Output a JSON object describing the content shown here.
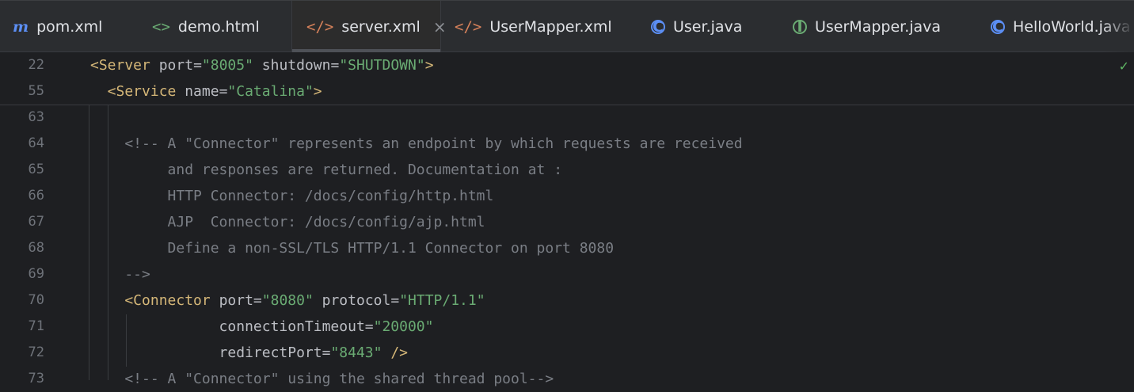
{
  "tabs": [
    {
      "label": "pom.xml",
      "icon": "maven-m-icon",
      "active": false
    },
    {
      "label": "demo.html",
      "icon": "html-tag-icon",
      "active": false
    },
    {
      "label": "server.xml",
      "icon": "xml-tag-icon",
      "active": true
    },
    {
      "label": "UserMapper.xml",
      "icon": "xml-tag-icon",
      "active": false
    },
    {
      "label": "User.java",
      "icon": "java-class-icon",
      "active": false
    },
    {
      "label": "UserMapper.java",
      "icon": "java-interface-icon",
      "active": false
    },
    {
      "label": "HelloWorld.java",
      "icon": "java-class-run-icon",
      "active": false
    }
  ],
  "tab_close_glyph": "×",
  "icon_glyphs": {
    "maven": "m",
    "html": "<>",
    "xml": "</>",
    "class": "C",
    "iface": "I"
  },
  "inspection_status": "✓",
  "editor": {
    "lines": [
      {
        "num": "22",
        "sticky": true,
        "segments": [
          [
            "tag",
            "<Server "
          ],
          [
            "attr",
            "port"
          ],
          [
            "pl",
            "="
          ],
          [
            "str",
            "\"8005\""
          ],
          [
            "attr",
            " shutdown"
          ],
          [
            "pl",
            "="
          ],
          [
            "str",
            "\"SHUTDOWN\""
          ],
          [
            "tag",
            ">"
          ]
        ]
      },
      {
        "num": "55",
        "sticky": true,
        "segments": [
          [
            "tag",
            "  <Service "
          ],
          [
            "attr",
            "name"
          ],
          [
            "pl",
            "="
          ],
          [
            "str",
            "\"Catalina\""
          ],
          [
            "tag",
            ">"
          ]
        ]
      },
      {
        "num": "63",
        "segments": []
      },
      {
        "num": "64",
        "segments": [
          [
            "cmt",
            "    <!-- A \"Connector\" represents an endpoint by which requests are received"
          ]
        ]
      },
      {
        "num": "65",
        "segments": [
          [
            "cmt",
            "         and responses are returned. Documentation at :"
          ]
        ]
      },
      {
        "num": "66",
        "segments": [
          [
            "cmt",
            "         HTTP Connector: /docs/config/http.html"
          ]
        ]
      },
      {
        "num": "67",
        "segments": [
          [
            "cmt",
            "         AJP  Connector: /docs/config/ajp.html"
          ]
        ]
      },
      {
        "num": "68",
        "segments": [
          [
            "cmt",
            "         Define a non-SSL/TLS HTTP/1.1 Connector on port 8080"
          ]
        ]
      },
      {
        "num": "69",
        "segments": [
          [
            "cmt",
            "    -->"
          ]
        ]
      },
      {
        "num": "70",
        "segments": [
          [
            "tag",
            "    <Connector "
          ],
          [
            "attr",
            "port"
          ],
          [
            "pl",
            "="
          ],
          [
            "str",
            "\"8080\""
          ],
          [
            "attr",
            " protocol"
          ],
          [
            "pl",
            "="
          ],
          [
            "str",
            "\"HTTP/1.1\""
          ]
        ]
      },
      {
        "num": "71",
        "segments": [
          [
            "attr",
            "               connectionTimeout"
          ],
          [
            "pl",
            "="
          ],
          [
            "str",
            "\"20000\""
          ]
        ]
      },
      {
        "num": "72",
        "segments": [
          [
            "attr",
            "               redirectPort"
          ],
          [
            "pl",
            "="
          ],
          [
            "str",
            "\"8443\""
          ],
          [
            "tag",
            " />"
          ]
        ]
      },
      {
        "num": "73",
        "segments": [
          [
            "cmt",
            "    <!-- A \"Connector\" using the shared thread pool-->"
          ]
        ]
      }
    ]
  }
}
